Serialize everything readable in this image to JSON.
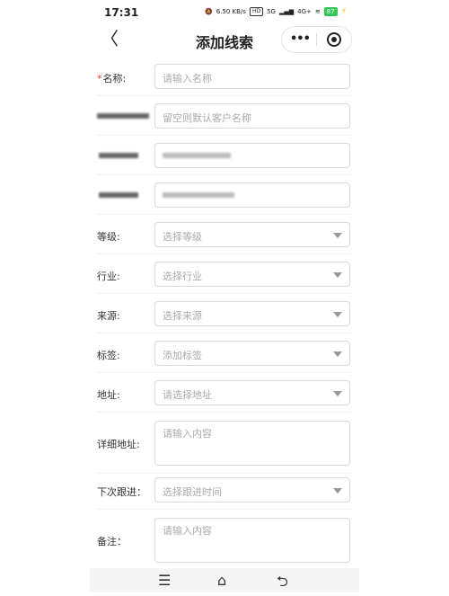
{
  "status_bar": {
    "time": "17:31",
    "net_speed": "6.50",
    "net_unit": "KB/s",
    "hd": "HD",
    "sig1": "5G",
    "sig2": "4G+",
    "battery": "87"
  },
  "nav": {
    "title": "添加线索",
    "more": "•••"
  },
  "form": {
    "name": {
      "required": "*",
      "label": "名称:",
      "placeholder": "请输入名称"
    },
    "customer_placeholder": "留空则默认客户名称",
    "level": {
      "label": "等级:",
      "placeholder": "选择等级"
    },
    "industry": {
      "label": "行业:",
      "placeholder": "选择行业"
    },
    "source": {
      "label": "来源:",
      "placeholder": "选择来源"
    },
    "tags": {
      "label": "标签:",
      "placeholder": "添加标签"
    },
    "region": {
      "label": "地址:",
      "placeholder": "请选择地址"
    },
    "detail_address": {
      "label": "详细地址:",
      "placeholder": "请输入内容"
    },
    "next_follow": {
      "label": "下次跟进：",
      "placeholder": "选择跟进时间"
    },
    "remark": {
      "label": "备注：",
      "placeholder": "请输入内容"
    }
  },
  "gesture_bar": {
    "menu": "☰",
    "home": "⌂",
    "back": "⮌"
  }
}
